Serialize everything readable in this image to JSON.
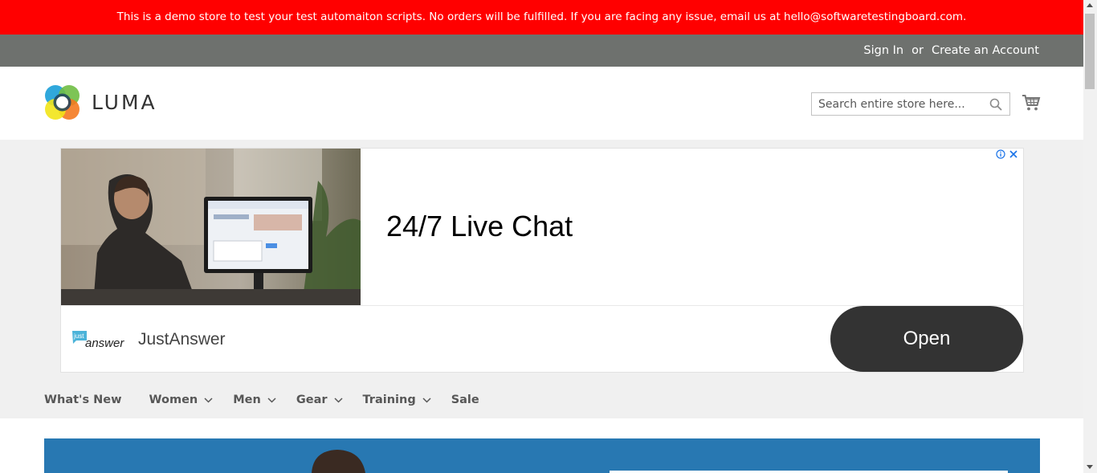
{
  "demo_notice": "This is a demo store to test your test automaiton scripts. No orders will be fulfilled. If you are facing any issue, email us at hello@softwaretestingboard.com.",
  "top_links": {
    "sign_in": "Sign In",
    "or": "or",
    "create_account": "Create an Account"
  },
  "logo_text": "LUMA",
  "search": {
    "placeholder": "Search entire store here...",
    "value": ""
  },
  "ad": {
    "headline": "24/7 Live Chat",
    "brand_logo_line1": "just",
    "brand_logo_line2": "answer",
    "brand_name": "JustAnswer",
    "cta": "Open",
    "info_icon": "info-icon",
    "close_icon": "close-icon"
  },
  "nav": {
    "items": [
      {
        "label": "What's New"
      },
      {
        "label": "Women"
      },
      {
        "label": "Men"
      },
      {
        "label": "Gear"
      },
      {
        "label": "Training"
      },
      {
        "label": "Sale"
      }
    ]
  },
  "colors": {
    "demo_banner": "#ff0000",
    "top_bar": "#6e716e",
    "nav_bg": "#f0f0f0",
    "nav_text": "#575757",
    "ad_button": "#333333",
    "hero_bg": "#2e80b8"
  }
}
